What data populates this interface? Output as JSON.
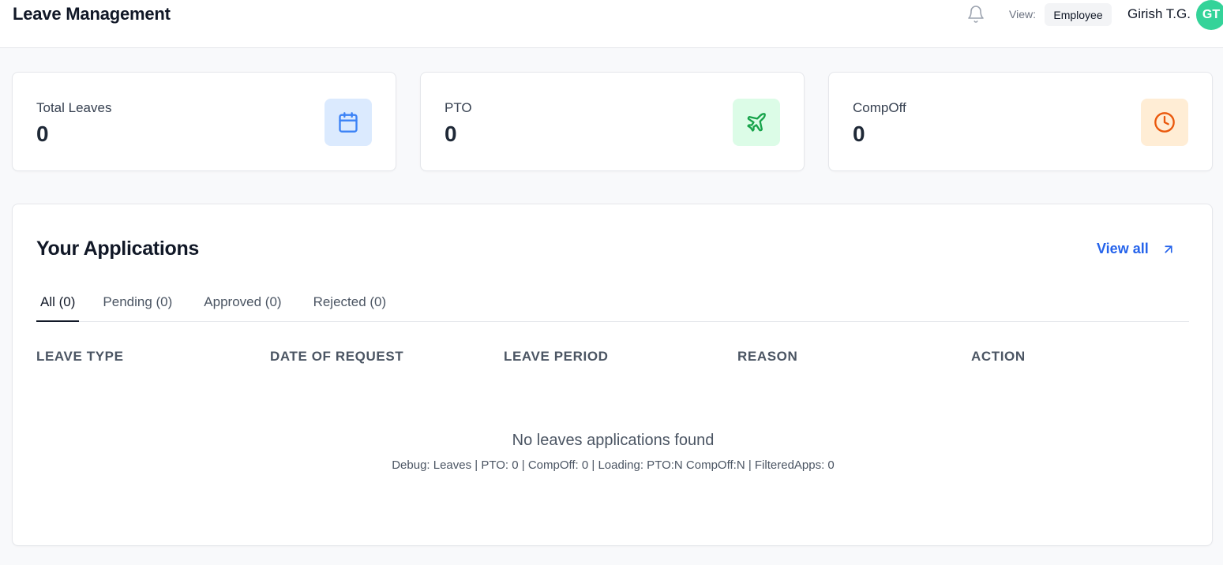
{
  "header": {
    "title": "Leave Management",
    "view_label": "View:",
    "view_value": "Employee",
    "user_name": "Girish T.G.",
    "avatar_initials": "GT"
  },
  "stats": [
    {
      "label": "Total Leaves",
      "value": "0",
      "icon": "calendar-icon",
      "icon_color": "#3b82f6",
      "icon_bg": "#dbeafe"
    },
    {
      "label": "PTO",
      "value": "0",
      "icon": "plane-icon",
      "icon_color": "#16a34a",
      "icon_bg": "#dcfce7"
    },
    {
      "label": "CompOff",
      "value": "0",
      "icon": "clock-icon",
      "icon_color": "#ea580c",
      "icon_bg": "#ffedd5"
    }
  ],
  "applications": {
    "title": "Your Applications",
    "view_all_label": "View all",
    "tabs": [
      {
        "label": "All (0)",
        "active": true
      },
      {
        "label": "Pending (0)",
        "active": false
      },
      {
        "label": "Approved (0)",
        "active": false
      },
      {
        "label": "Rejected (0)",
        "active": false
      }
    ],
    "columns": [
      "LEAVE TYPE",
      "DATE OF REQUEST",
      "LEAVE PERIOD",
      "REASON",
      "ACTION"
    ],
    "empty_message": "No leaves applications found",
    "debug_text": "Debug: Leaves | PTO: 0 | CompOff: 0 | Loading: PTO:N CompOff:N | FilteredApps: 0"
  },
  "colors": {
    "accent": "#2563eb",
    "avatar_bg": "#34d399"
  }
}
